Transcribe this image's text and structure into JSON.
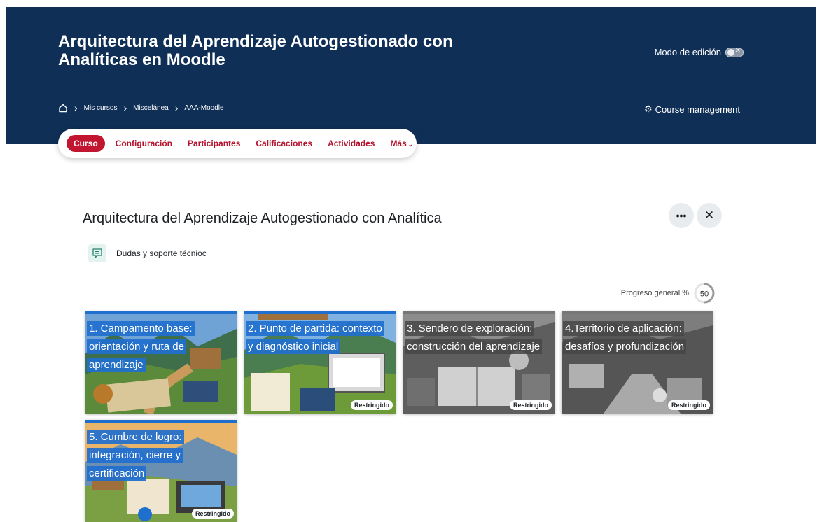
{
  "header": {
    "course_title": "Arquitectura del Aprendizaje Autogestionado con Analíticas en Moodle",
    "edit_mode_label": "Modo de edición",
    "course_management_label": "Course management",
    "breadcrumb": [
      "Mis cursos",
      "Miscelánea",
      "AAA-Moodle"
    ]
  },
  "tabs": [
    {
      "label": "Curso",
      "active": true
    },
    {
      "label": "Configuración",
      "active": false
    },
    {
      "label": "Participantes",
      "active": false
    },
    {
      "label": "Calificaciones",
      "active": false
    },
    {
      "label": "Actividades",
      "active": false
    },
    {
      "label": "Más",
      "active": false
    }
  ],
  "section": {
    "title": "Arquitectura del Aprendizaje Autogestionado con Analítica",
    "forum_label": "Dudas y soporte técnioc"
  },
  "progress": {
    "label": "Progreso general %",
    "value": 50
  },
  "cards": [
    {
      "title": "1. Campamento base: orientación y ruta de aprendizaje",
      "restricted": "",
      "grayscale": false
    },
    {
      "title": "2. Punto de partida: contexto y diagnóstico inicial",
      "restricted": "Restringido",
      "grayscale": false
    },
    {
      "title": "3. Sendero de exploración: construcción del aprendizaje",
      "restricted": "Restringido",
      "grayscale": true
    },
    {
      "title": "4.Territorio de aplicación: desafíos y profundización",
      "restricted": "Restringido",
      "grayscale": true
    },
    {
      "title": "5. Cumbre de logro: integración, cierre y certificación",
      "restricted": "Restringido",
      "grayscale": false
    }
  ],
  "colors": {
    "header_bg": "#0f2f57",
    "brand_red": "#c2152f",
    "card_title_bg": "#1f6fcf"
  }
}
